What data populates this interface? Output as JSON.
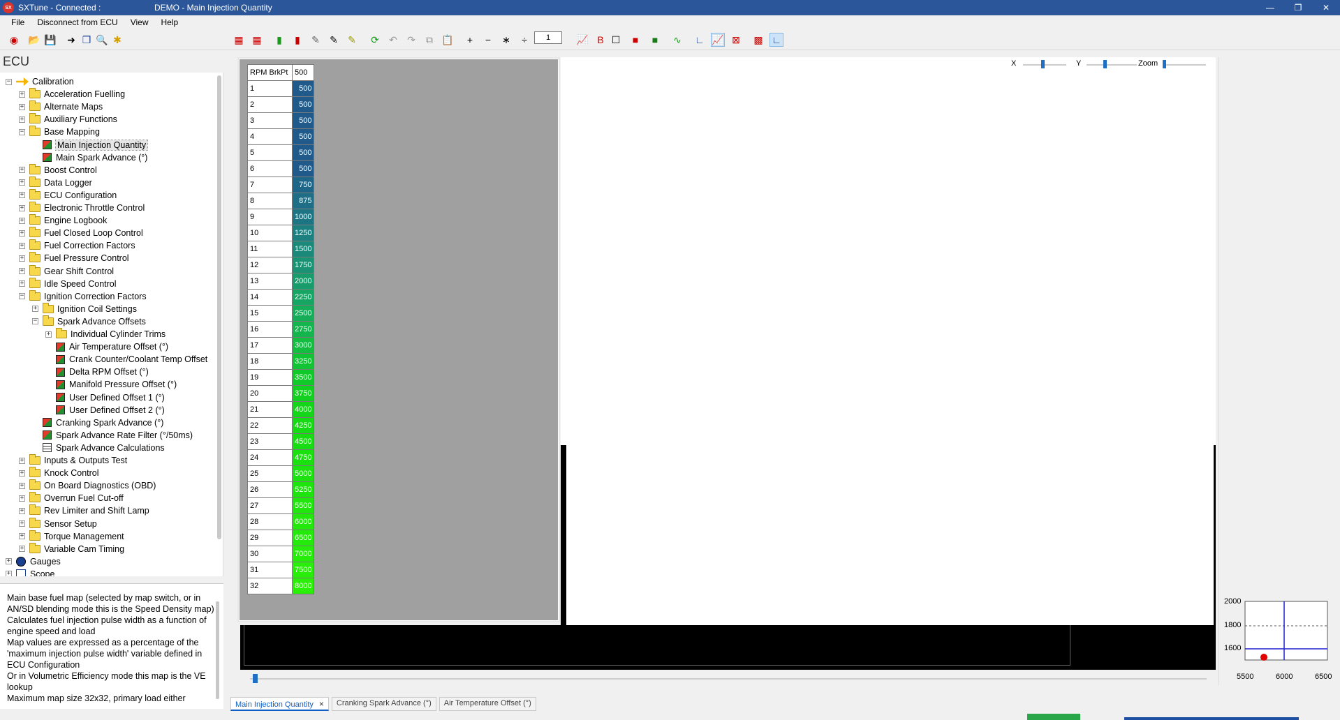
{
  "window": {
    "app_title": "SXTune - Connected :",
    "doc_title": "DEMO - Main Injection Quantity",
    "controls": [
      "—",
      "❐",
      "✕"
    ]
  },
  "menu": [
    "File",
    "Disconnect from ECU",
    "View",
    "Help"
  ],
  "toolbar": {
    "page_value": "1"
  },
  "ecu_heading": "ECU",
  "tree": [
    {
      "label": "Calibration",
      "icon": "calibration",
      "exp": "−"
    },
    {
      "label": "Acceleration Fuelling",
      "icon": "folder",
      "exp": "+"
    },
    {
      "label": "Alternate Maps",
      "icon": "folder",
      "exp": "+"
    },
    {
      "label": "Auxiliary Functions",
      "icon": "folder",
      "exp": "+"
    },
    {
      "label": "Base Mapping",
      "icon": "folder",
      "exp": "−"
    },
    {
      "label": "Main Injection Quantity",
      "icon": "cube",
      "exp": "",
      "selected": true
    },
    {
      "label": "Main Spark Advance (°)",
      "icon": "cube",
      "exp": ""
    },
    {
      "label": "Boost Control",
      "icon": "folder",
      "exp": "+"
    },
    {
      "label": "Data Logger",
      "icon": "folder",
      "exp": "+"
    },
    {
      "label": "ECU Configuration",
      "icon": "folder",
      "exp": "+"
    },
    {
      "label": "Electronic Throttle Control",
      "icon": "folder",
      "exp": "+"
    },
    {
      "label": "Engine Logbook",
      "icon": "folder",
      "exp": "+"
    },
    {
      "label": "Fuel Closed Loop Control",
      "icon": "folder",
      "exp": "+"
    },
    {
      "label": "Fuel Correction Factors",
      "icon": "folder",
      "exp": "+"
    },
    {
      "label": "Fuel Pressure Control",
      "icon": "folder",
      "exp": "+"
    },
    {
      "label": "Gear Shift Control",
      "icon": "folder",
      "exp": "+"
    },
    {
      "label": "Idle Speed Control",
      "icon": "folder",
      "exp": "+"
    },
    {
      "label": "Ignition Correction Factors",
      "icon": "folder",
      "exp": "−"
    },
    {
      "label": "Ignition Coil Settings",
      "icon": "folder",
      "exp": "+"
    },
    {
      "label": "Spark Advance Offsets",
      "icon": "folder",
      "exp": "−"
    },
    {
      "label": "Individual Cylinder Trims",
      "icon": "folder",
      "exp": "+"
    },
    {
      "label": "Air Temperature Offset (°)",
      "icon": "cube",
      "exp": ""
    },
    {
      "label": "Crank Counter/Coolant Temp Offset",
      "icon": "cube",
      "exp": ""
    },
    {
      "label": "Delta RPM Offset (°)",
      "icon": "cube",
      "exp": ""
    },
    {
      "label": "Manifold Pressure Offset (°)",
      "icon": "cube",
      "exp": ""
    },
    {
      "label": "User Defined Offset 1 (°)",
      "icon": "cube",
      "exp": ""
    },
    {
      "label": "User Defined Offset 2 (°)",
      "icon": "cube",
      "exp": ""
    },
    {
      "label": "Cranking Spark Advance (°)",
      "icon": "cube",
      "exp": ""
    },
    {
      "label": "Spark Advance Rate Filter (°/50ms)",
      "icon": "cube",
      "exp": ""
    },
    {
      "label": "Spark Advance Calculations",
      "icon": "grid",
      "exp": ""
    },
    {
      "label": "Inputs & Outputs Test",
      "icon": "folder",
      "exp": "+"
    },
    {
      "label": "Knock Control",
      "icon": "folder",
      "exp": "+"
    },
    {
      "label": "On Board Diagnostics (OBD)",
      "icon": "folder",
      "exp": "+"
    },
    {
      "label": "Overrun Fuel Cut-off",
      "icon": "folder",
      "exp": "+"
    },
    {
      "label": "Rev Limiter and Shift Lamp",
      "icon": "folder",
      "exp": "+"
    },
    {
      "label": "Sensor Setup",
      "icon": "folder",
      "exp": "+"
    },
    {
      "label": "Torque Management",
      "icon": "folder",
      "exp": "+"
    },
    {
      "label": "Variable Cam Timing",
      "icon": "folder",
      "exp": "+"
    },
    {
      "label": "Gauges",
      "icon": "gauge",
      "exp": "+"
    },
    {
      "label": "Scope",
      "icon": "scope",
      "exp": "+"
    }
  ],
  "description": [
    "Main base fuel map (selected by map switch, or in AN/SD blending mode this is the Speed Density map)",
    "Calculates fuel injection pulse width as a function of engine speed and load",
    "Map values are expressed as a percentage of the 'maximum injection pulse width' variable defined in ECU Configuration",
    "Or in Volumetric Efficiency mode this map is the VE lookup",
    "Maximum map size 32x32, primary load either"
  ],
  "table": {
    "header_row": "RPM BrkPt",
    "header_col": "500",
    "rows": [
      "1",
      "2",
      "3",
      "4",
      "5",
      "6",
      "7",
      "8",
      "9",
      "10",
      "11",
      "12",
      "13",
      "14",
      "15",
      "16",
      "17",
      "18",
      "19",
      "20",
      "21",
      "22",
      "23",
      "24",
      "25",
      "26",
      "27",
      "28",
      "29",
      "30",
      "31",
      "32"
    ],
    "values": [
      "500",
      "500",
      "500",
      "500",
      "500",
      "500",
      "750",
      "875",
      "1000",
      "1250",
      "1500",
      "1750",
      "2000",
      "2250",
      "2500",
      "2750",
      "3000",
      "3250",
      "3500",
      "3750",
      "4000",
      "4250",
      "4500",
      "4750",
      "5000",
      "5250",
      "5500",
      "6000",
      "6500",
      "7000",
      "7500",
      "8000"
    ],
    "colors": [
      "#1f5a8a",
      "#1f5a8a",
      "#1f5a8a",
      "#1f5a8a",
      "#1f5a8a",
      "#1f5a8a",
      "#1e6688",
      "#1e6e86",
      "#1d7584",
      "#1c7f80",
      "#1b897a",
      "#1a9374",
      "#199c6c",
      "#17a563",
      "#15ad58",
      "#14b54c",
      "#12bd40",
      "#11c434",
      "#10ca2a",
      "#12d020",
      "#14d618",
      "#16da14",
      "#18dd12",
      "#1ae010",
      "#1ce20f",
      "#1ee40e",
      "#20e60d",
      "#22e80c",
      "#24ea0b",
      "#26ec0a",
      "#28ee09",
      "#2af008"
    ]
  },
  "graph": {
    "x_label": "X",
    "y_label": "Y",
    "zoom_label": "Zoom"
  },
  "mini_chart": {
    "y_ticks": [
      "2000",
      "1800",
      "1600"
    ],
    "x_ticks": [
      "5500",
      "6000",
      "6500"
    ]
  },
  "tabs": [
    {
      "label": "Main Injection Quantity",
      "close": "×"
    },
    {
      "label": "Cranking Spark Advance (°)"
    },
    {
      "label": "Air Temperature Offset (°)"
    }
  ]
}
